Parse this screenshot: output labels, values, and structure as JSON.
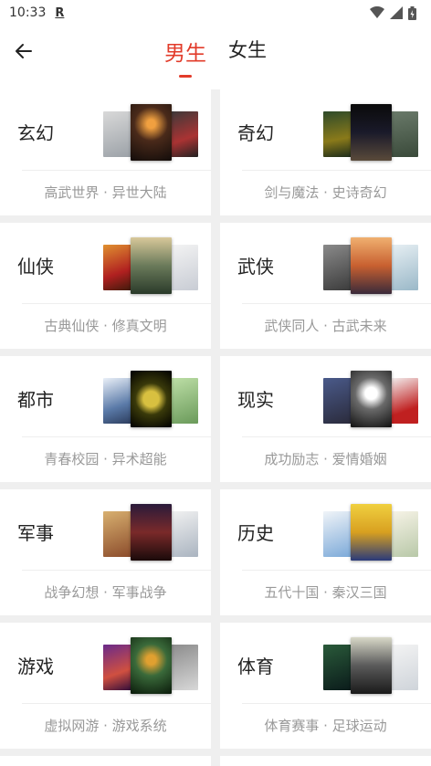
{
  "status": {
    "time": "10:33",
    "indicator": "R"
  },
  "tabs": [
    {
      "label": "男生",
      "active": true
    },
    {
      "label": "女生",
      "active": false
    }
  ],
  "colors": {
    "accent": "#e23b2a",
    "subtext": "#999999"
  },
  "categories": [
    {
      "title": "玄幻",
      "subtitle": "高武世界 · 异世大陆"
    },
    {
      "title": "奇幻",
      "subtitle": "剑与魔法 · 史诗奇幻"
    },
    {
      "title": "仙侠",
      "subtitle": "古典仙侠 · 修真文明"
    },
    {
      "title": "武侠",
      "subtitle": "武侠同人 · 古武未来"
    },
    {
      "title": "都市",
      "subtitle": "青春校园 · 异术超能"
    },
    {
      "title": "现实",
      "subtitle": "成功励志 · 爱情婚姻"
    },
    {
      "title": "军事",
      "subtitle": "战争幻想 · 军事战争"
    },
    {
      "title": "历史",
      "subtitle": "五代十国 · 秦汉三国"
    },
    {
      "title": "游戏",
      "subtitle": "虚拟网游 · 游戏系统"
    },
    {
      "title": "体育",
      "subtitle": "体育赛事 · 足球运动"
    }
  ]
}
